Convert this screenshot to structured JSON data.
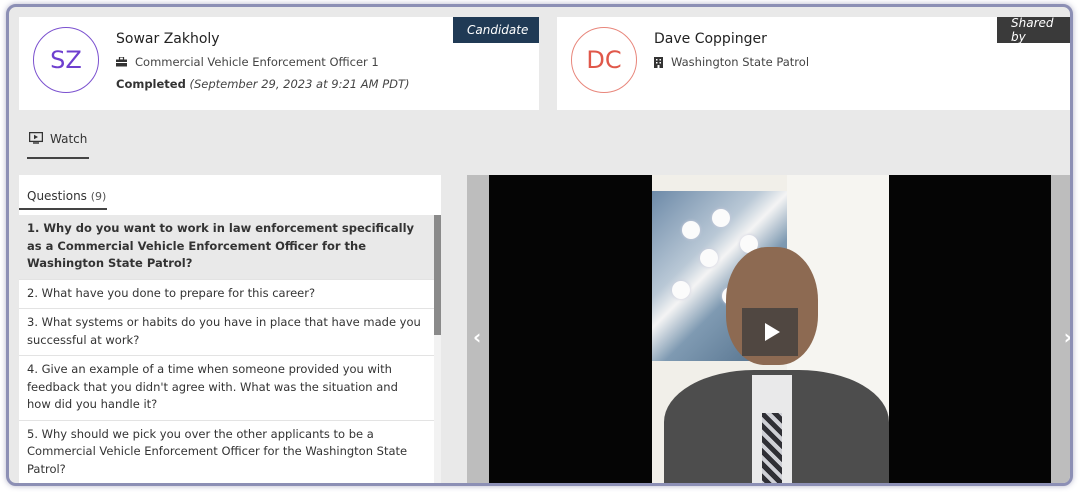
{
  "candidate": {
    "initials": "SZ",
    "name": "Sowar Zakholy",
    "role": "Commercial Vehicle Enforcement Officer 1",
    "status_label": "Completed",
    "status_date": "(September 29, 2023 at 9:21 AM PDT)",
    "tag": "Candidate",
    "role_icon": "briefcase-icon"
  },
  "sharer": {
    "initials": "DC",
    "name": "Dave Coppinger",
    "org": "Washington State Patrol",
    "tag": "Shared by",
    "org_icon": "building-icon"
  },
  "tabs": {
    "watch_label": "Watch",
    "watch_icon": "monitor-play-icon"
  },
  "questions": {
    "title": "Questions",
    "count": "(9)",
    "items": [
      "1. Why do you want to work in law enforcement specifically as a Commercial Vehicle Enforcement Officer for the Washington State Patrol?",
      "2. What have you done to prepare for this career?",
      "3. What systems or habits do you have in place that have made you successful at work?",
      "4. Give an example of a time when someone provided you with feedback that you didn't agree with. What was the situation and how did you handle it?",
      "5. Why should we pick you over the other applicants to be a Commercial Vehicle Enforcement Officer for the Washington State Patrol?"
    ]
  },
  "video": {
    "prev_icon": "chevron-left-icon",
    "next_icon": "chevron-right-icon",
    "play_icon": "play-icon"
  },
  "colors": {
    "candidate_tag": "#203a55",
    "shared_tag": "#3a3a3a",
    "candidate_avatar": "#6e3fcf",
    "sharer_avatar": "#e0584a"
  }
}
